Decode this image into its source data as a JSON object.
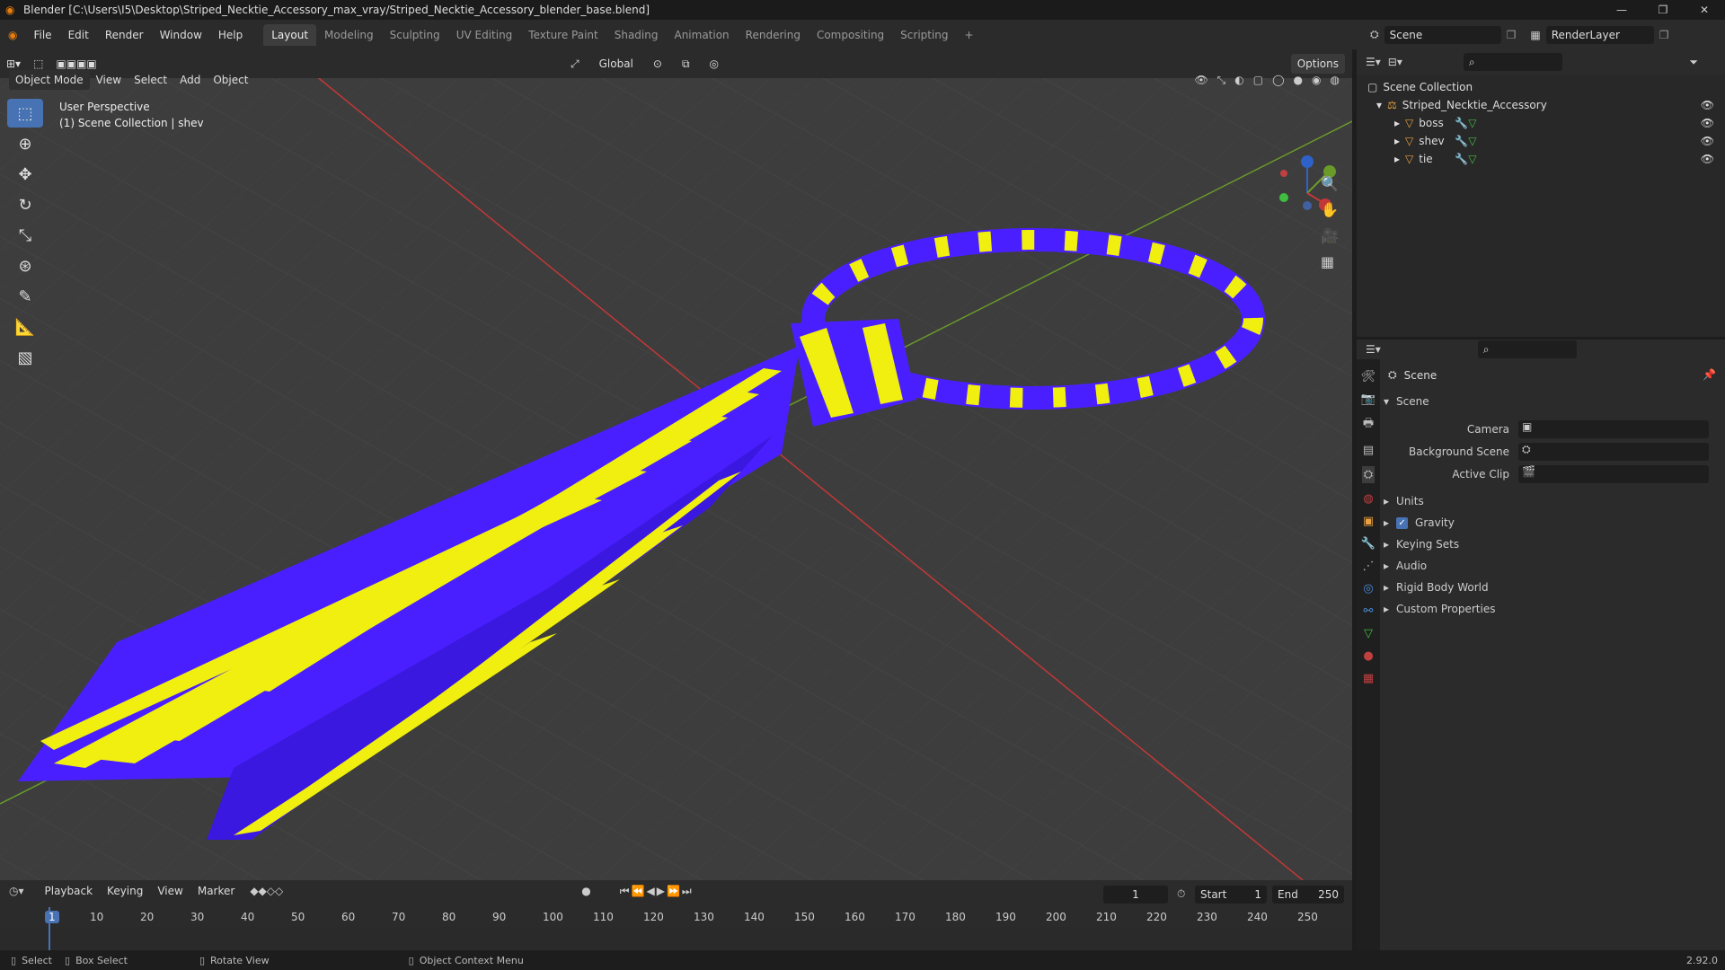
{
  "titlebar": {
    "title": "Blender [C:\\Users\\I5\\Desktop\\Striped_Necktie_Accessory_max_vray/Striped_Necktie_Accessory_blender_base.blend]"
  },
  "menu": [
    "File",
    "Edit",
    "Render",
    "Window",
    "Help"
  ],
  "workspaces": [
    "Layout",
    "Modeling",
    "Sculpting",
    "UV Editing",
    "Texture Paint",
    "Shading",
    "Animation",
    "Rendering",
    "Compositing",
    "Scripting"
  ],
  "scene": {
    "name": "Scene",
    "render_layer": "RenderLayer"
  },
  "viewport": {
    "mode": "Object Mode",
    "menus": [
      "View",
      "Select",
      "Add",
      "Object"
    ],
    "transform": "Global",
    "options": "Options",
    "overlay_line1": "User Perspective",
    "overlay_line2": "(1) Scene Collection | shev",
    "colors": {
      "tie_blue": "#4a1fff",
      "tie_yellow": "#f0ef10",
      "grid_bg": "#3d3d3d",
      "x_axis": "#c23838",
      "y_axis": "#6a9a2a"
    }
  },
  "outliner": {
    "root": "Scene Collection",
    "collection": "Striped_Necktie_Accessory",
    "objects": [
      "boss",
      "shev",
      "tie"
    ]
  },
  "properties": {
    "header": "Scene",
    "section": "Scene",
    "camera_label": "Camera",
    "bg_scene_label": "Background Scene",
    "active_clip_label": "Active Clip",
    "panels": [
      "Units",
      "Gravity",
      "Keying Sets",
      "Audio",
      "Rigid Body World",
      "Custom Properties"
    ],
    "gravity_checked": true
  },
  "timeline": {
    "menus": [
      "Playback",
      "Keying",
      "View",
      "Marker"
    ],
    "current_frame": "1",
    "start_label": "Start",
    "start": "1",
    "end_label": "End",
    "end": "250",
    "ticks": [
      "1",
      "10",
      "20",
      "30",
      "40",
      "50",
      "60",
      "70",
      "80",
      "90",
      "100",
      "110",
      "120",
      "130",
      "140",
      "150",
      "160",
      "170",
      "180",
      "190",
      "200",
      "210",
      "220",
      "230",
      "240",
      "250"
    ]
  },
  "status": {
    "select": "Select",
    "box_select": "Box Select",
    "rotate": "Rotate View",
    "context": "Object Context Menu",
    "version": "2.92.0"
  }
}
